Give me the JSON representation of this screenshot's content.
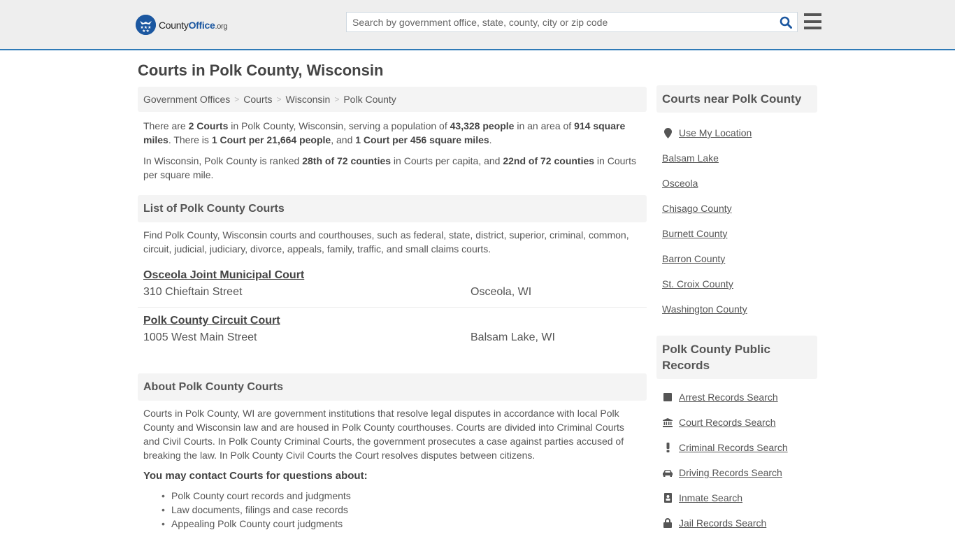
{
  "header": {
    "logo": {
      "part1": "County",
      "part2": "Office",
      "part3": ".org"
    },
    "search_placeholder": "Search by government office, state, county, city or zip code"
  },
  "page_title": "Courts in Polk County, Wisconsin",
  "breadcrumb": [
    "Government Offices",
    "Courts",
    "Wisconsin",
    "Polk County"
  ],
  "intro": {
    "p1": [
      {
        "t": "There are ",
        "b": false
      },
      {
        "t": "2 Courts",
        "b": true
      },
      {
        "t": " in Polk County, Wisconsin, serving a population of ",
        "b": false
      },
      {
        "t": "43,328 people",
        "b": true
      },
      {
        "t": " in an area of ",
        "b": false
      },
      {
        "t": "914 square miles",
        "b": true
      },
      {
        "t": ". There is ",
        "b": false
      },
      {
        "t": "1 Court per 21,664 people",
        "b": true
      },
      {
        "t": ", and ",
        "b": false
      },
      {
        "t": "1 Court per 456 square miles",
        "b": true
      },
      {
        "t": ".",
        "b": false
      }
    ],
    "p2": [
      {
        "t": "In Wisconsin, Polk County is ranked ",
        "b": false
      },
      {
        "t": "28th of 72 counties",
        "b": true
      },
      {
        "t": " in Courts per capita, and ",
        "b": false
      },
      {
        "t": "22nd of 72 counties",
        "b": true
      },
      {
        "t": " in Courts per square mile.",
        "b": false
      }
    ]
  },
  "list_section": {
    "title": "List of Polk County Courts",
    "intro": "Find Polk County, Wisconsin courts and courthouses, such as federal, state, district, superior, criminal, common, circuit, judicial, judiciary, divorce, appeals, family, traffic, and small claims courts.",
    "courts": [
      {
        "name": "Osceola Joint Municipal Court",
        "street": "310 Chieftain Street",
        "city": "Osceola, WI"
      },
      {
        "name": "Polk County Circuit Court",
        "street": "1005 West Main Street",
        "city": "Balsam Lake, WI"
      }
    ]
  },
  "about_section": {
    "title": "About Polk County Courts",
    "text": "Courts in Polk County, WI are government institutions that resolve legal disputes in accordance with local Polk County and Wisconsin law and are housed in Polk County courthouses. Courts are divided into Criminal Courts and Civil Courts. In Polk County Criminal Courts, the government prosecutes a case against parties accused of breaking the law. In Polk County Civil Courts the Court resolves disputes between citizens.",
    "contact_heading": "You may contact Courts for questions about:",
    "contact_items": [
      "Polk County court records and judgments",
      "Law documents, filings and case records",
      "Appealing Polk County court judgments"
    ]
  },
  "sidebar": {
    "nearby_title": "Courts near Polk County",
    "use_location": "Use My Location",
    "nearby": [
      "Balsam Lake",
      "Osceola",
      "Chisago County",
      "Burnett County",
      "Barron County",
      "St. Croix County",
      "Washington County"
    ],
    "records_title": "Polk County Public Records",
    "records": [
      {
        "label": "Arrest Records Search",
        "icon": "square-icon"
      },
      {
        "label": "Court Records Search",
        "icon": "courthouse-icon"
      },
      {
        "label": "Criminal Records Search",
        "icon": "exclamation-icon"
      },
      {
        "label": "Driving Records Search",
        "icon": "car-icon"
      },
      {
        "label": "Inmate Search",
        "icon": "id-badge-icon"
      },
      {
        "label": "Jail Records Search",
        "icon": "lock-icon"
      }
    ]
  }
}
